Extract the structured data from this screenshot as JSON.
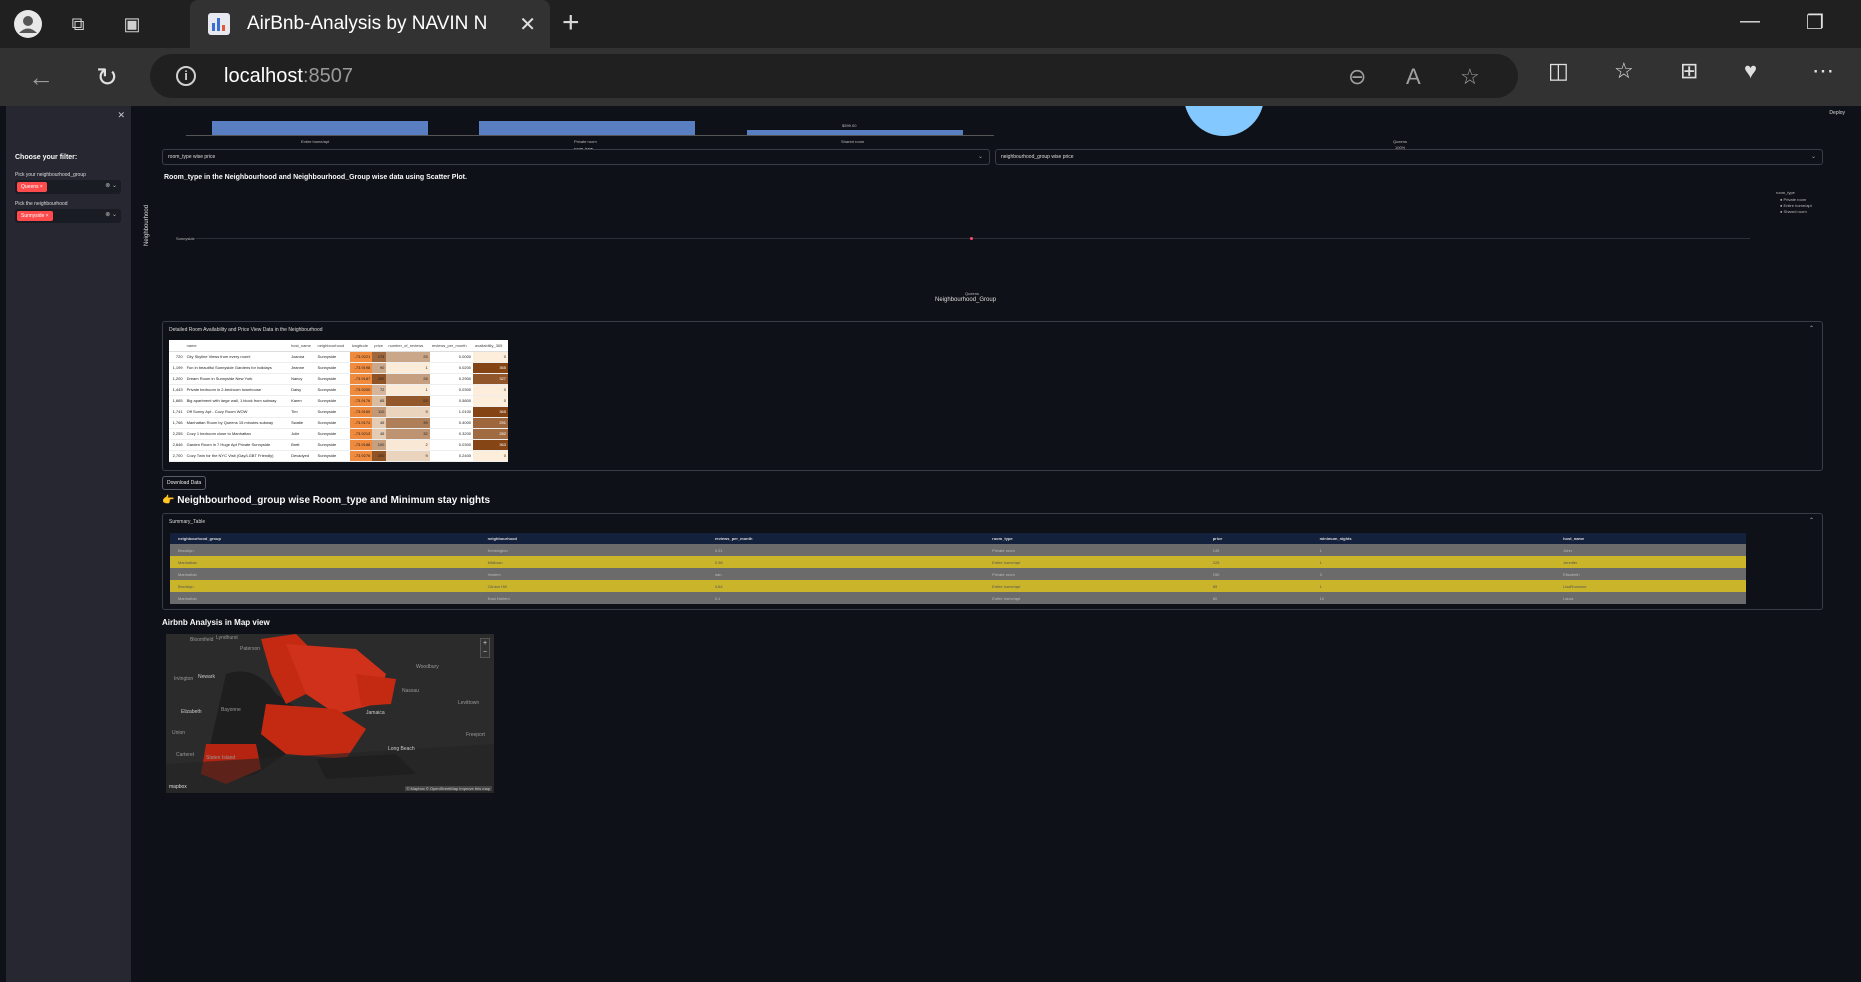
{
  "browser": {
    "tab_title": "AirBnb-Analysis by NAVIN N",
    "url_host": "localhost",
    "url_port": ":8507"
  },
  "sidebar": {
    "heading": "Choose your filter:",
    "filters": [
      {
        "label": "Pick your neighbourhood_group",
        "chip": "Queens"
      },
      {
        "label": "Pick the neighbourhood",
        "chip": "Sunnyside"
      }
    ]
  },
  "header": {
    "deploy": "Deploy"
  },
  "top_bar_chart": {
    "categories": [
      "Entire home/apt",
      "Private room",
      "Shared room"
    ],
    "xlabel": "room_type",
    "value_label": "$599.00",
    "pie_label": "Queens",
    "pie_pct": "100%"
  },
  "dropdowns": [
    "room_type wise price",
    "neighbourhood_group wise price"
  ],
  "scatter": {
    "title": "Room_type in the Neighbourhood and Neighbourhood_Group wise data using Scatter Plot.",
    "ylabel": "Neighbourhood",
    "xlabel": "Neighbourhood_Group",
    "ytick": "Sunnyside",
    "xtick": "Queens",
    "legend_title": "room_type",
    "legend": [
      "Private room",
      "Entire home/apt",
      "Shared room"
    ]
  },
  "detail": {
    "title": "Detailed Room Availability and Price View Data in the Neighbourhood",
    "columns": [
      "",
      "name",
      "host_name",
      "neighbourhood",
      "longitude",
      "price",
      "number_of_reviews",
      "reviews_per_month",
      "availability_365"
    ],
    "rows": [
      [
        "720",
        "City Skyline Views from every room!",
        "Joanna",
        "Sunnyside",
        "-73.9221",
        "175",
        "25",
        "0.0000",
        "0"
      ],
      [
        "1,199",
        "Fun in beautiful Sunnyside Gardens for holidays",
        "Jeanne",
        "Sunnyside",
        "-73.9198",
        "90",
        "1",
        "0.0200",
        "365"
      ],
      [
        "1,200",
        "Dream Room in Sunnyside New York",
        "Nancy",
        "Sunnyside",
        "-73.9187",
        "200",
        "28",
        "0.2900",
        "327"
      ],
      [
        "1,443",
        "Private bedroom in 2-bedroom townhouse",
        "Daisy",
        "Sunnyside",
        "-73.9200",
        "72",
        "1",
        "0.0300",
        "0"
      ],
      [
        "1,665",
        "Big apartment with large wall, 1 block from subway",
        "Karen",
        "Sunnyside",
        "-73.9176",
        "65",
        "53",
        "0.5800",
        "0"
      ],
      [
        "1,741",
        "Off Sunny Apt - Cozy Room WOW",
        "Tim",
        "Sunnyside",
        "-73.9160",
        "110",
        "9",
        "1.0100",
        "365"
      ],
      [
        "1,766",
        "Manhattan Room by Queens 15 minutes subway",
        "Swatie",
        "Sunnyside",
        "-73.9174",
        "45",
        "39",
        "0.4000",
        "291"
      ],
      [
        "2,255",
        "Cozy 1 bedroom close to Manhattan",
        "Julie",
        "Sunnyside",
        "-73.9213",
        "45",
        "32",
        "0.3200",
        "282"
      ],
      [
        "2,646",
        "Garden Room in 7 Huge Apt Private Sunnyside",
        "Brett",
        "Sunnyside",
        "-73.9188",
        "100",
        "2",
        "0.0300",
        "363"
      ],
      [
        "2,700",
        "Cozy Twin for the NYC Visit (Gay/LGBT Friendly)",
        "Devadyed",
        "Sunnyside",
        "-73.9276",
        "200",
        "9",
        "0.2400",
        "0"
      ]
    ]
  },
  "download_button": "Download Data",
  "summary_heading": "👉 Neighbourhood_group wise Room_type and Minimum stay nights",
  "summary": {
    "title": "Summary_Table",
    "columns": [
      "neighbourhood_group",
      "neighbourhood",
      "reviews_per_month",
      "room_type",
      "price",
      "minimum_nights",
      "host_name"
    ],
    "rows": [
      [
        "Brooklyn",
        "Kensington",
        "0.21",
        "Private room",
        "149",
        "1",
        "John"
      ],
      [
        "Manhattan",
        "Midtown",
        "0.38",
        "Entire home/apt",
        "225",
        "1",
        "Jennifer"
      ],
      [
        "Manhattan",
        "Harlem",
        "nan",
        "Private room",
        "150",
        "3",
        "Elisabeth"
      ],
      [
        "Brooklyn",
        "Clinton Hill",
        "4.64",
        "Entire home/apt",
        "89",
        "1",
        "LisaRoxanne"
      ],
      [
        "Manhattan",
        "East Harlem",
        "0.1",
        "Entire home/apt",
        "80",
        "10",
        "Laura"
      ]
    ]
  },
  "map": {
    "heading": "Airbnb Analysis in Map view",
    "labels": [
      "Bloomfield",
      "Lyndhurst",
      "Paterson",
      "Irvington",
      "Newark",
      "Elizabeth",
      "Bayonne",
      "Union",
      "Carteret",
      "Staten Island",
      "Woodbury",
      "Nassau",
      "Jamaica",
      "Long Beach",
      "Freeport",
      "Levittown"
    ],
    "attribution": "© Mapbox © OpenStreetMap  Improve this map",
    "brand": "mapbox"
  }
}
